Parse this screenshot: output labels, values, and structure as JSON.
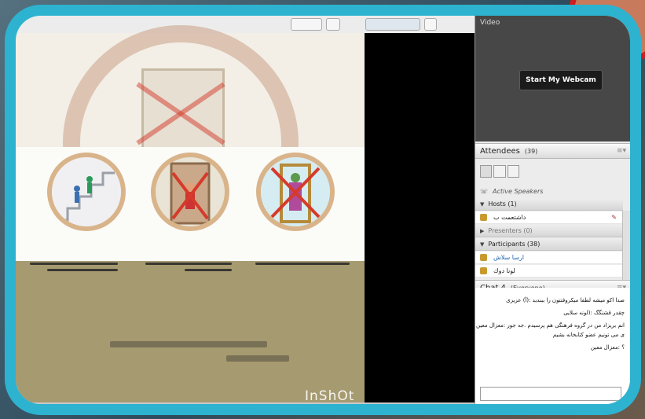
{
  "video": {
    "title": "Video",
    "webcam_button": "Start My Webcam"
  },
  "attendees": {
    "title": "Attendees",
    "count": "(39)",
    "active_speakers": "Active Speakers",
    "hosts_label": "Hosts (1)",
    "host_name": "داشتعمت ب",
    "presenters_label": "Presenters (0)",
    "participants_label": "Participants (38)",
    "participants": [
      "ارسا سلاش",
      "لونا دوك"
    ]
  },
  "chat": {
    "title": "Chat 4",
    "audience": "(Everyone)",
    "messages": [
      "صدا اکو میشه لطفا میکروفنتون را ببندید :(آ) عزیزی",
      "چقدر قشنگگ :(لونه سلایی",
      "انم بریزاد من در گروه فرهنگی هم پرسیدم .جه جور :معزال معین",
      "ی می تونیم عضو کتابخانه بشیم",
      "؟ :معزال معین"
    ]
  },
  "slide": {
    "watermark": "InShOt"
  },
  "colors": {
    "frame": "#2db3cf",
    "accent_red": "#d01d1d"
  }
}
